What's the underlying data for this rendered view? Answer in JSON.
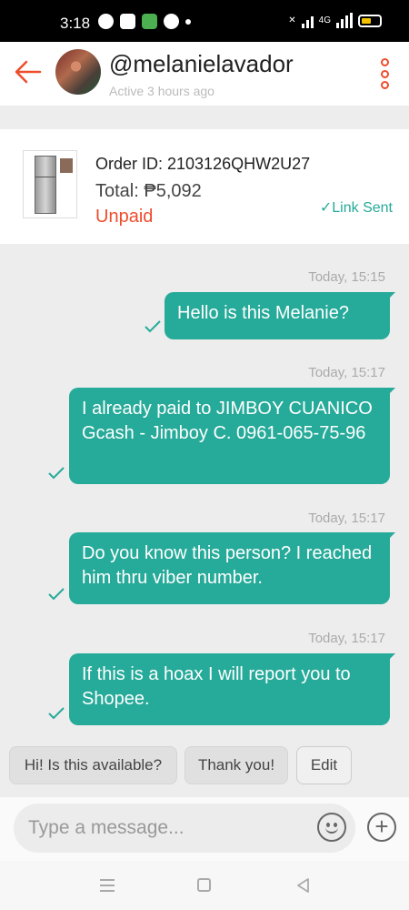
{
  "status_bar": {
    "time": "3:18",
    "network": "4G"
  },
  "header": {
    "username": "@melanielavador",
    "active_status": "Active 3 hours ago"
  },
  "order": {
    "order_id": "Order ID: 2103126QHW2U27",
    "total": "Total: ₱5,092",
    "status": "Unpaid",
    "link_status": "Link Sent"
  },
  "messages": [
    {
      "timestamp": "Today, 15:15",
      "text": "Hello is this Melanie?"
    },
    {
      "timestamp": "Today, 15:17",
      "text": "I already paid to JIMBOY CUANICO Gcash - Jimboy C. 0961-065-75-96"
    },
    {
      "timestamp": "Today, 15:17",
      "text": "Do you know this person? I reached him thru viber number."
    },
    {
      "timestamp": "Today, 15:17",
      "text": "If this is a hoax I will report you to Shopee."
    }
  ],
  "quick_replies": [
    "Hi! Is this available?",
    "Thank you!",
    "Edit"
  ],
  "composer": {
    "placeholder": "Type a message..."
  },
  "colors": {
    "accent": "#ee4d2d",
    "bubble": "#26aa99"
  }
}
